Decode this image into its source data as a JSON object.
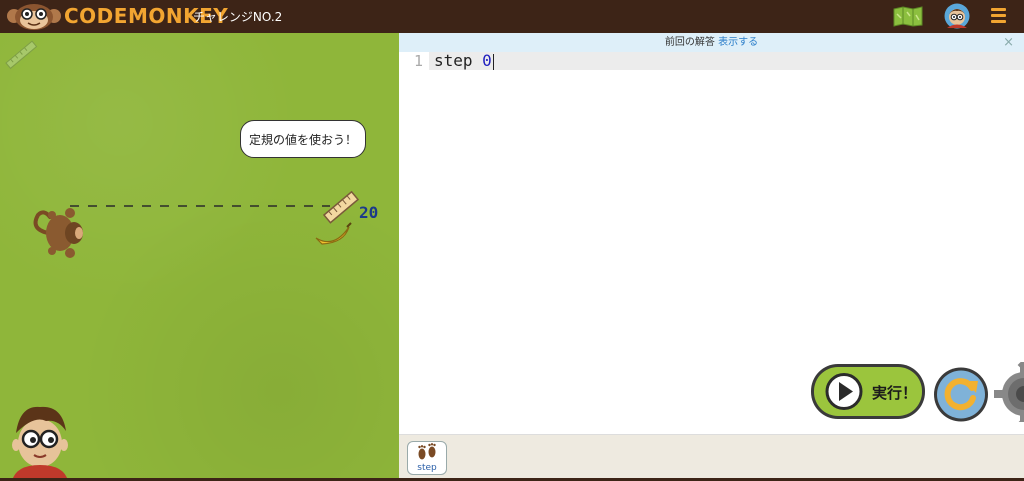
{
  "header": {
    "logo_text": "CODEMONKEY",
    "challenge_title": "チャレンジNO.2",
    "icons": [
      "monkey-logo-icon",
      "map-icon",
      "avatar-icon",
      "hamburger-menu-icon"
    ]
  },
  "game": {
    "speech_bubble": "定規の値を使おう！",
    "distance_value": "20",
    "characters": [
      "monkey",
      "banana",
      "ruler",
      "boy"
    ]
  },
  "editor": {
    "notice_text": "前回の解答",
    "notice_link": "表示する",
    "notice_close": "×",
    "lines": [
      {
        "number": "1",
        "keyword": "step",
        "value": "0"
      }
    ]
  },
  "controls": {
    "run_label": "実行！",
    "reset_icon": "reset-icon",
    "settings_icon": "gear-icon"
  },
  "palette": {
    "commands": [
      {
        "label": "step",
        "icon": "footprints-icon"
      }
    ]
  },
  "colors": {
    "header_bg": "#3d2417",
    "brand_orange": "#f2a531",
    "grass": "#8fb63a",
    "run_green": "#9bc53d",
    "reset_blue": "#7fb2d8",
    "number_blue": "#1f1fbf"
  }
}
